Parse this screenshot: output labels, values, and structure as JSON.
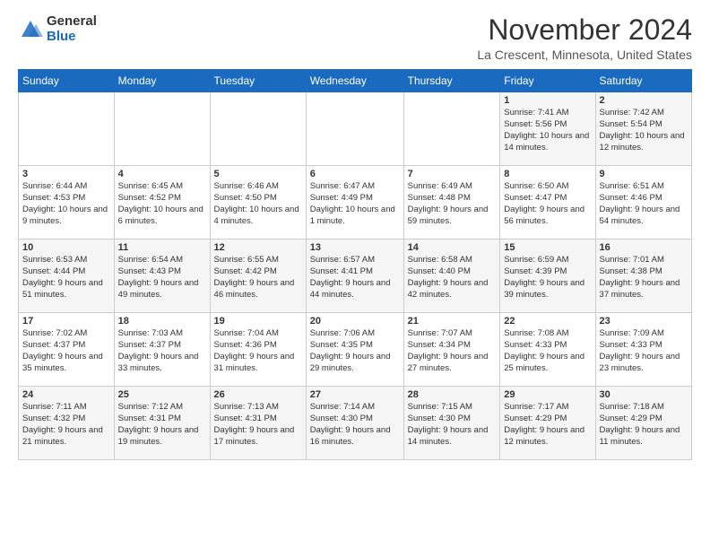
{
  "header": {
    "logo_general": "General",
    "logo_blue": "Blue",
    "month_title": "November 2024",
    "location": "La Crescent, Minnesota, United States"
  },
  "days_of_week": [
    "Sunday",
    "Monday",
    "Tuesday",
    "Wednesday",
    "Thursday",
    "Friday",
    "Saturday"
  ],
  "weeks": [
    [
      {
        "day": "",
        "info": ""
      },
      {
        "day": "",
        "info": ""
      },
      {
        "day": "",
        "info": ""
      },
      {
        "day": "",
        "info": ""
      },
      {
        "day": "",
        "info": ""
      },
      {
        "day": "1",
        "info": "Sunrise: 7:41 AM\nSunset: 5:56 PM\nDaylight: 10 hours and 14 minutes."
      },
      {
        "day": "2",
        "info": "Sunrise: 7:42 AM\nSunset: 5:54 PM\nDaylight: 10 hours and 12 minutes."
      }
    ],
    [
      {
        "day": "3",
        "info": "Sunrise: 6:44 AM\nSunset: 4:53 PM\nDaylight: 10 hours and 9 minutes."
      },
      {
        "day": "4",
        "info": "Sunrise: 6:45 AM\nSunset: 4:52 PM\nDaylight: 10 hours and 6 minutes."
      },
      {
        "day": "5",
        "info": "Sunrise: 6:46 AM\nSunset: 4:50 PM\nDaylight: 10 hours and 4 minutes."
      },
      {
        "day": "6",
        "info": "Sunrise: 6:47 AM\nSunset: 4:49 PM\nDaylight: 10 hours and 1 minute."
      },
      {
        "day": "7",
        "info": "Sunrise: 6:49 AM\nSunset: 4:48 PM\nDaylight: 9 hours and 59 minutes."
      },
      {
        "day": "8",
        "info": "Sunrise: 6:50 AM\nSunset: 4:47 PM\nDaylight: 9 hours and 56 minutes."
      },
      {
        "day": "9",
        "info": "Sunrise: 6:51 AM\nSunset: 4:46 PM\nDaylight: 9 hours and 54 minutes."
      }
    ],
    [
      {
        "day": "10",
        "info": "Sunrise: 6:53 AM\nSunset: 4:44 PM\nDaylight: 9 hours and 51 minutes."
      },
      {
        "day": "11",
        "info": "Sunrise: 6:54 AM\nSunset: 4:43 PM\nDaylight: 9 hours and 49 minutes."
      },
      {
        "day": "12",
        "info": "Sunrise: 6:55 AM\nSunset: 4:42 PM\nDaylight: 9 hours and 46 minutes."
      },
      {
        "day": "13",
        "info": "Sunrise: 6:57 AM\nSunset: 4:41 PM\nDaylight: 9 hours and 44 minutes."
      },
      {
        "day": "14",
        "info": "Sunrise: 6:58 AM\nSunset: 4:40 PM\nDaylight: 9 hours and 42 minutes."
      },
      {
        "day": "15",
        "info": "Sunrise: 6:59 AM\nSunset: 4:39 PM\nDaylight: 9 hours and 39 minutes."
      },
      {
        "day": "16",
        "info": "Sunrise: 7:01 AM\nSunset: 4:38 PM\nDaylight: 9 hours and 37 minutes."
      }
    ],
    [
      {
        "day": "17",
        "info": "Sunrise: 7:02 AM\nSunset: 4:37 PM\nDaylight: 9 hours and 35 minutes."
      },
      {
        "day": "18",
        "info": "Sunrise: 7:03 AM\nSunset: 4:37 PM\nDaylight: 9 hours and 33 minutes."
      },
      {
        "day": "19",
        "info": "Sunrise: 7:04 AM\nSunset: 4:36 PM\nDaylight: 9 hours and 31 minutes."
      },
      {
        "day": "20",
        "info": "Sunrise: 7:06 AM\nSunset: 4:35 PM\nDaylight: 9 hours and 29 minutes."
      },
      {
        "day": "21",
        "info": "Sunrise: 7:07 AM\nSunset: 4:34 PM\nDaylight: 9 hours and 27 minutes."
      },
      {
        "day": "22",
        "info": "Sunrise: 7:08 AM\nSunset: 4:33 PM\nDaylight: 9 hours and 25 minutes."
      },
      {
        "day": "23",
        "info": "Sunrise: 7:09 AM\nSunset: 4:33 PM\nDaylight: 9 hours and 23 minutes."
      }
    ],
    [
      {
        "day": "24",
        "info": "Sunrise: 7:11 AM\nSunset: 4:32 PM\nDaylight: 9 hours and 21 minutes."
      },
      {
        "day": "25",
        "info": "Sunrise: 7:12 AM\nSunset: 4:31 PM\nDaylight: 9 hours and 19 minutes."
      },
      {
        "day": "26",
        "info": "Sunrise: 7:13 AM\nSunset: 4:31 PM\nDaylight: 9 hours and 17 minutes."
      },
      {
        "day": "27",
        "info": "Sunrise: 7:14 AM\nSunset: 4:30 PM\nDaylight: 9 hours and 16 minutes."
      },
      {
        "day": "28",
        "info": "Sunrise: 7:15 AM\nSunset: 4:30 PM\nDaylight: 9 hours and 14 minutes."
      },
      {
        "day": "29",
        "info": "Sunrise: 7:17 AM\nSunset: 4:29 PM\nDaylight: 9 hours and 12 minutes."
      },
      {
        "day": "30",
        "info": "Sunrise: 7:18 AM\nSunset: 4:29 PM\nDaylight: 9 hours and 11 minutes."
      }
    ]
  ]
}
